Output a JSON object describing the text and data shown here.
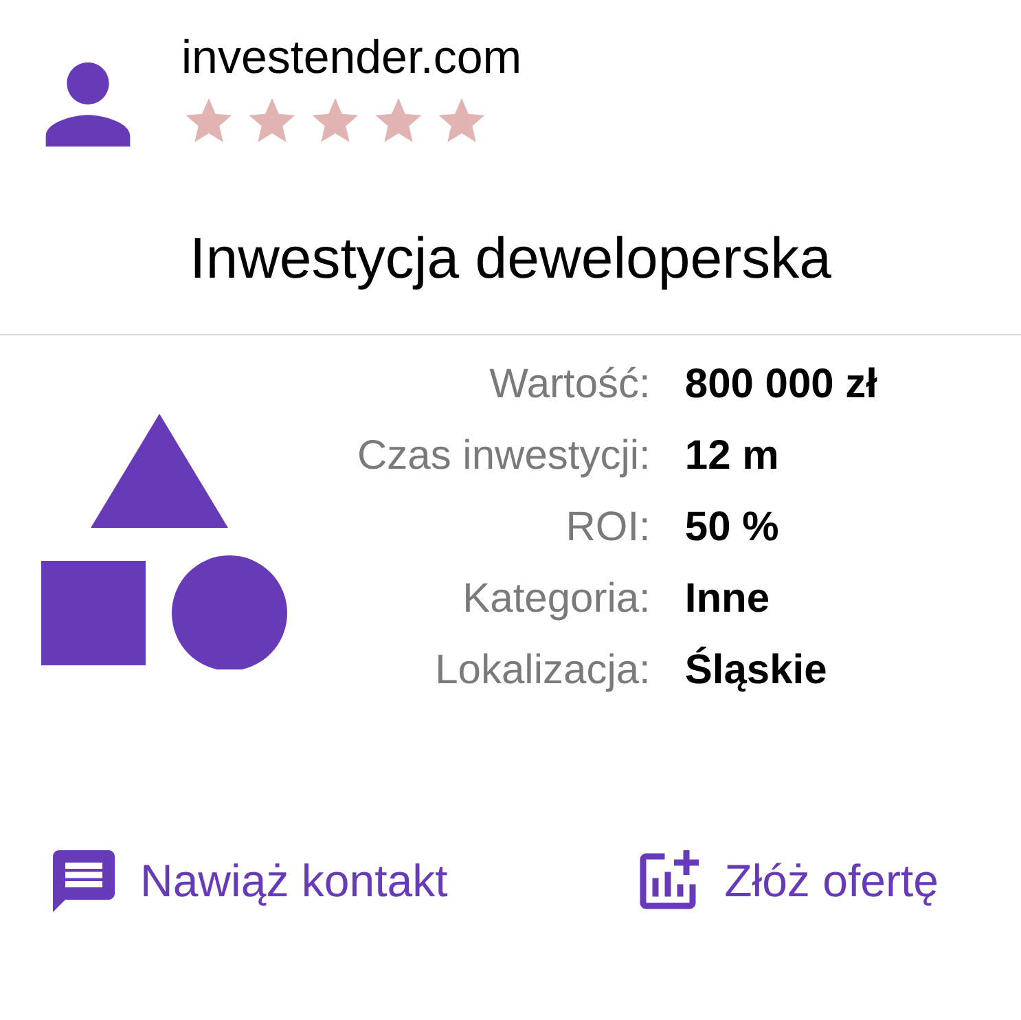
{
  "header": {
    "site": "investender.com",
    "stars": 5
  },
  "title": "Inwestycja deweloperska",
  "details": [
    {
      "label": "Wartość:",
      "value": "800 000 zł"
    },
    {
      "label": "Czas inwestycji:",
      "value": "12 m"
    },
    {
      "label": "ROI:",
      "value": "50 %"
    },
    {
      "label": "Kategoria:",
      "value": "Inne"
    },
    {
      "label": "Lokalizacja:",
      "value": "Śląskie"
    }
  ],
  "actions": [
    {
      "kind": "contact",
      "label": "Nawiąż kontakt"
    },
    {
      "kind": "offer",
      "label": "Złóż ofertę"
    }
  ]
}
